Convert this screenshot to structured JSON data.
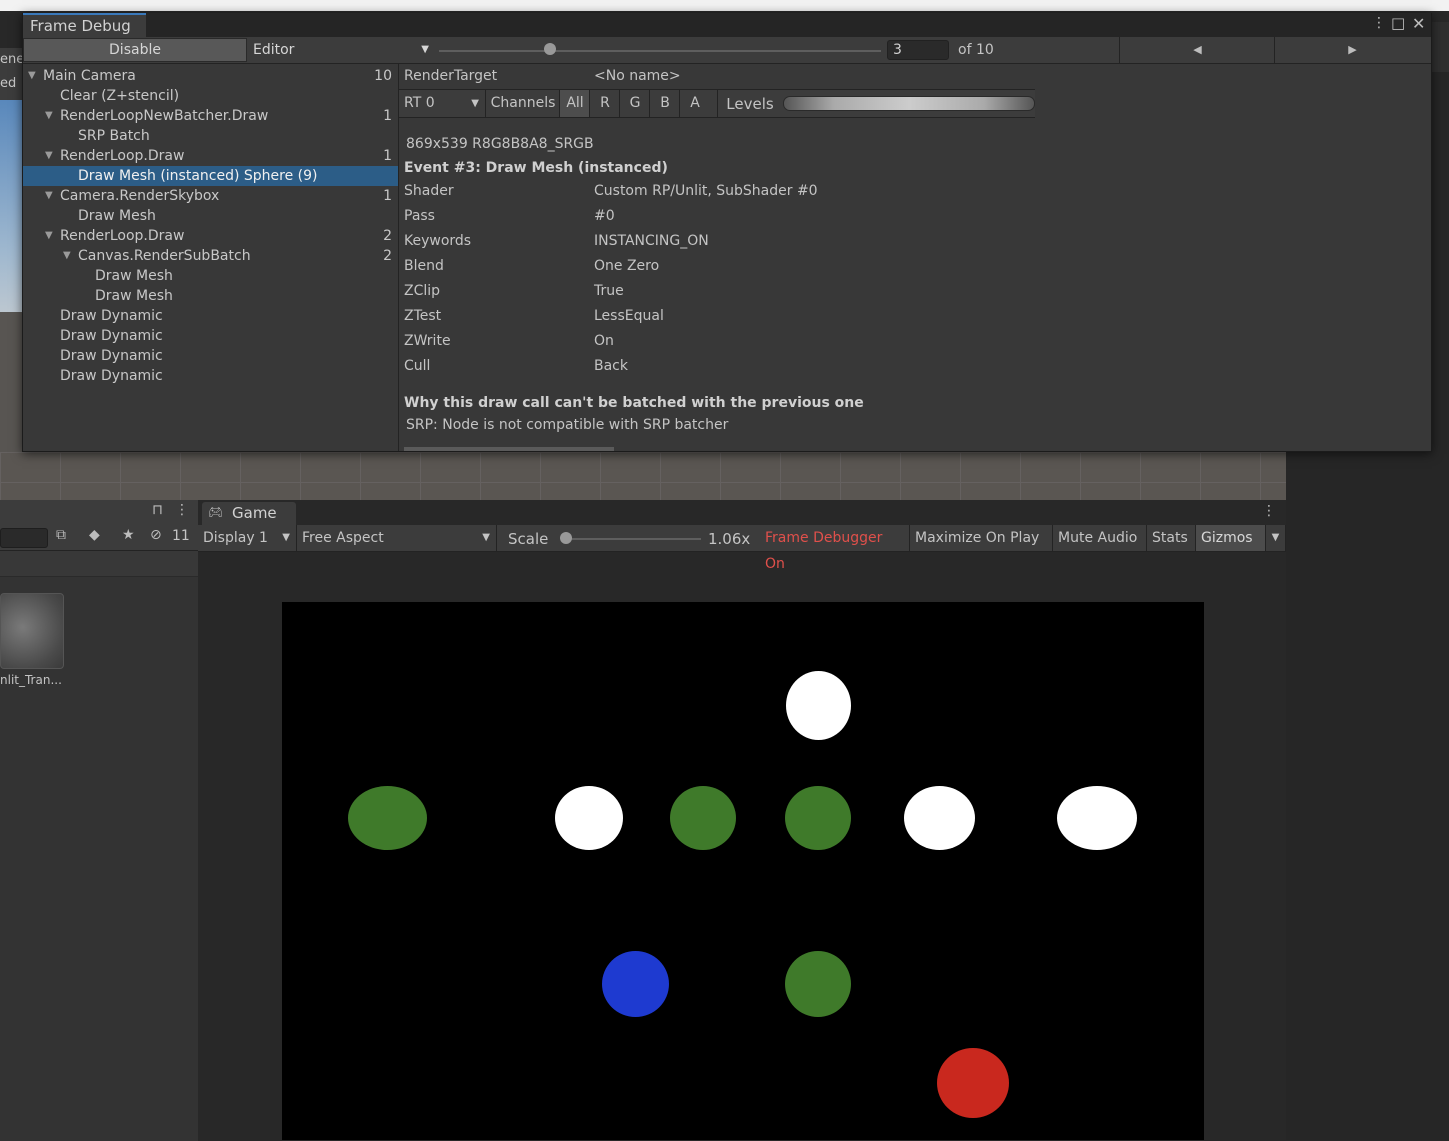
{
  "scene": {
    "tab_text_1": "ene",
    "tab_text_2": "ed"
  },
  "project": {
    "hidden_count": "11",
    "asset_label": "nlit_Tran..."
  },
  "game": {
    "tab_label": "Game",
    "display": "Display 1",
    "aspect": "Free Aspect",
    "scale_label": "Scale",
    "scale_value": "1.06x",
    "frame_debugger_on": "Frame Debugger On",
    "maximize_on_play": "Maximize On Play",
    "mute_audio": "Mute Audio",
    "stats": "Stats",
    "gizmos": "Gizmos",
    "spheres": [
      {
        "color": "#ffffff"
      },
      {
        "color": "#3f7a2a"
      },
      {
        "color": "#ffffff"
      },
      {
        "color": "#3f7a2a"
      },
      {
        "color": "#3f7a2a"
      },
      {
        "color": "#ffffff"
      },
      {
        "color": "#ffffff"
      },
      {
        "color": "#1e3ad0"
      },
      {
        "color": "#3f7a2a"
      },
      {
        "color": "#c9281e"
      }
    ]
  },
  "frame_debug": {
    "title": "Frame Debug",
    "disable_label": "Disable",
    "target": "Editor",
    "current_event": "3",
    "event_total": "of 10",
    "slider_fraction": 0.25,
    "tree": [
      {
        "label": "Main Camera",
        "count": "10",
        "arrow": true
      },
      {
        "label": "Clear (Z+stencil)",
        "count": "",
        "arrow": false
      },
      {
        "label": "RenderLoopNewBatcher.Draw",
        "count": "1",
        "arrow": true
      },
      {
        "label": "SRP Batch",
        "count": "",
        "arrow": false
      },
      {
        "label": "RenderLoop.Draw",
        "count": "1",
        "arrow": true
      },
      {
        "label": "Draw Mesh (instanced) Sphere (9)",
        "count": "",
        "arrow": false,
        "selected": true
      },
      {
        "label": "Camera.RenderSkybox",
        "count": "1",
        "arrow": true
      },
      {
        "label": "Draw Mesh",
        "count": "",
        "arrow": false
      },
      {
        "label": "RenderLoop.Draw",
        "count": "2",
        "arrow": true
      },
      {
        "label": "Canvas.RenderSubBatch",
        "count": "2",
        "arrow": true
      },
      {
        "label": "Draw Mesh",
        "count": "",
        "arrow": false
      },
      {
        "label": "Draw Mesh",
        "count": "",
        "arrow": false
      },
      {
        "label": "Draw Dynamic",
        "count": "",
        "arrow": false
      },
      {
        "label": "Draw Dynamic",
        "count": "",
        "arrow": false
      },
      {
        "label": "Draw Dynamic",
        "count": "",
        "arrow": false
      },
      {
        "label": "Draw Dynamic",
        "count": "",
        "arrow": false
      }
    ],
    "render_target_label": "RenderTarget",
    "render_target_value": "<No name>",
    "rt_select": "RT 0",
    "channels_label": "Channels",
    "channels": [
      "All",
      "R",
      "G",
      "B",
      "A"
    ],
    "levels_label": "Levels",
    "format": "869x539 R8G8B8A8_SRGB",
    "event_title": "Event #3: Draw Mesh (instanced)",
    "properties": [
      {
        "label": "Shader",
        "value": "Custom RP/Unlit, SubShader #0"
      },
      {
        "label": "Pass",
        "value": "#0"
      },
      {
        "label": "Keywords",
        "value": "INSTANCING_ON"
      },
      {
        "label": "Blend",
        "value": "One Zero"
      },
      {
        "label": "ZClip",
        "value": "True"
      },
      {
        "label": "ZTest",
        "value": "LessEqual"
      },
      {
        "label": "ZWrite",
        "value": "On"
      },
      {
        "label": "Cull",
        "value": "Back"
      }
    ],
    "batch_heading": "Why this draw call can't be batched with the previous one",
    "batch_reason": "SRP: Node is not compatible with SRP batcher"
  }
}
